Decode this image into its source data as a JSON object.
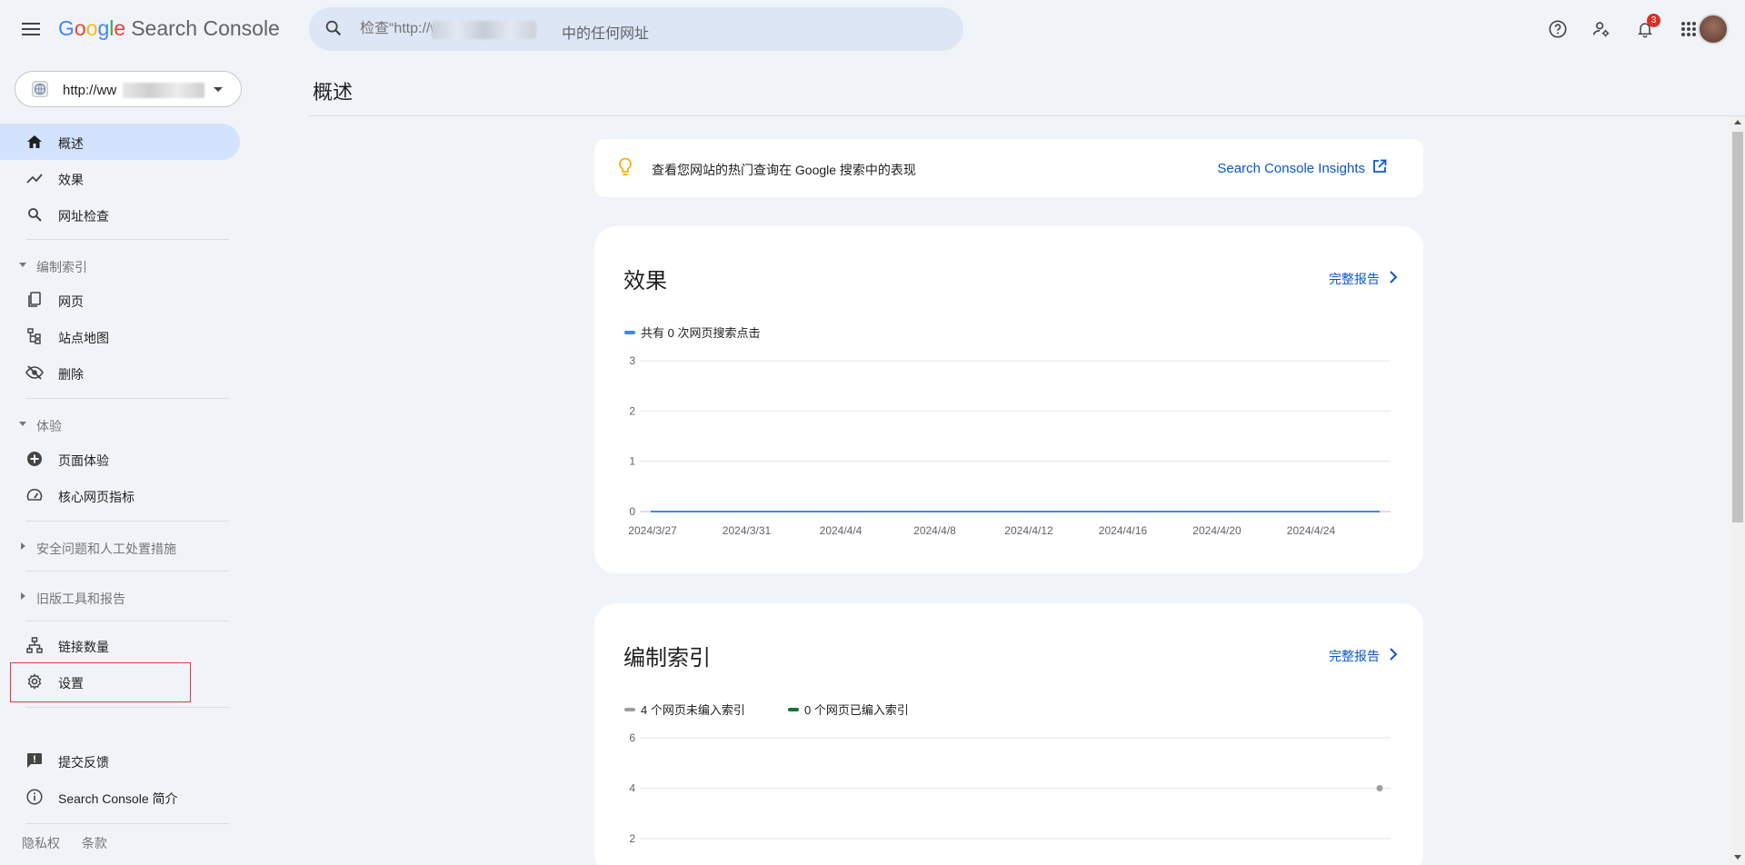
{
  "header": {
    "logo_google": "Google",
    "product_name": "Search Console",
    "search_prefix": "检查“http://ww",
    "search_suffix": "中的任何网址",
    "notification_count": "3"
  },
  "sidebar": {
    "property": "http://ww",
    "items": {
      "overview": "概述",
      "performance": "效果",
      "url_inspection": "网址检查",
      "indexing_section": "编制索引",
      "pages": "网页",
      "sitemaps": "站点地图",
      "removals": "删除",
      "experience_section": "体验",
      "page_experience": "页面体验",
      "core_web_vitals": "核心网页指标",
      "security_section": "安全问题和人工处置措施",
      "legacy_section": "旧版工具和报告",
      "links": "链接数量",
      "settings": "设置",
      "feedback": "提交反馈",
      "about": "Search Console 简介"
    },
    "footer": {
      "privacy": "隐私权",
      "terms": "条款"
    }
  },
  "main": {
    "page_title": "概述",
    "insights": {
      "text": "查看您网站的热门查询在 Google 搜索中的表现",
      "link": "Search Console Insights"
    },
    "performance_card": {
      "title": "效果",
      "full_report": "完整报告",
      "legend": "共有 0 次网页搜索点击"
    },
    "indexing_card": {
      "title": "编制索引",
      "full_report": "完整报告",
      "legend_not_indexed": "4 个网页未编入索引",
      "legend_indexed": "0 个网页已编入索引"
    }
  },
  "colors": {
    "accent": "#0b57d0",
    "active_nav": "#d3e3fd",
    "clicks_line": "#4285f4",
    "not_indexed": "#9e9e9e",
    "indexed": "#137333",
    "highlight": "#e0383e"
  },
  "chart_data": [
    {
      "type": "line",
      "title": "效果",
      "categories": [
        "2024/3/27",
        "2024/3/31",
        "2024/4/4",
        "2024/4/8",
        "2024/4/12",
        "2024/4/16",
        "2024/4/20",
        "2024/4/24"
      ],
      "series": [
        {
          "name": "共有 0 次网页搜索点击",
          "values": [
            0,
            0,
            0,
            0,
            0,
            0,
            0,
            0
          ]
        }
      ],
      "yticks": [
        "0",
        "1",
        "2",
        "3"
      ],
      "ylim": [
        0,
        3
      ],
      "grid": true
    },
    {
      "type": "line",
      "title": "编制索引",
      "series": [
        {
          "name": "4 个网页未编入索引",
          "values": [
            4
          ]
        },
        {
          "name": "0 个网页已编入索引",
          "values": [
            0
          ]
        }
      ],
      "yticks": [
        "2",
        "4",
        "6"
      ],
      "ylim": [
        0,
        6
      ],
      "grid": true
    }
  ]
}
